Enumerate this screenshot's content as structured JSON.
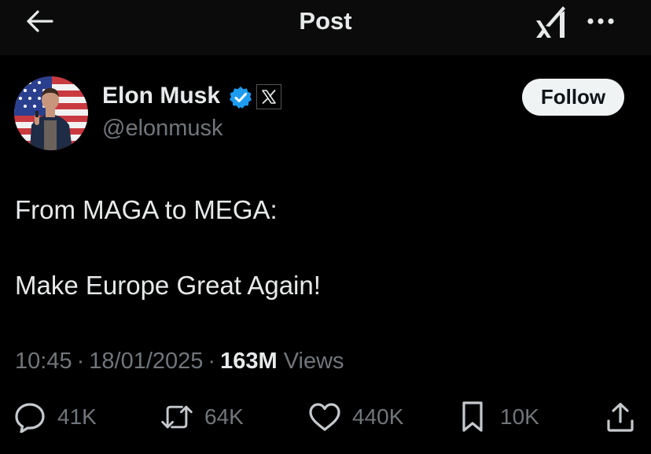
{
  "header": {
    "title": "Post",
    "back_icon": "arrow-left-icon",
    "grok_icon": "grok-icon",
    "more_icon": "more-icon"
  },
  "author": {
    "name": "Elon Musk",
    "handle": "@elonmusk",
    "verified": true,
    "verified_color": "#1d9bf0",
    "affiliate_badge": "X"
  },
  "follow_label": "Follow",
  "tweet": {
    "line1": "From MAGA to MEGA:",
    "line2": "Make Europe Great Again!"
  },
  "meta": {
    "time": "10:45",
    "date": "18/01/2025",
    "views_count": "163M",
    "views_label": "Views"
  },
  "actions": {
    "replies": "41K",
    "reposts": "64K",
    "likes": "440K",
    "bookmarks": "10K"
  },
  "colors": {
    "background": "#000000",
    "header_bg": "#0b0b0b",
    "text_primary": "#e7e9ea",
    "text_secondary": "#71767b",
    "follow_bg": "#eff3f4"
  }
}
